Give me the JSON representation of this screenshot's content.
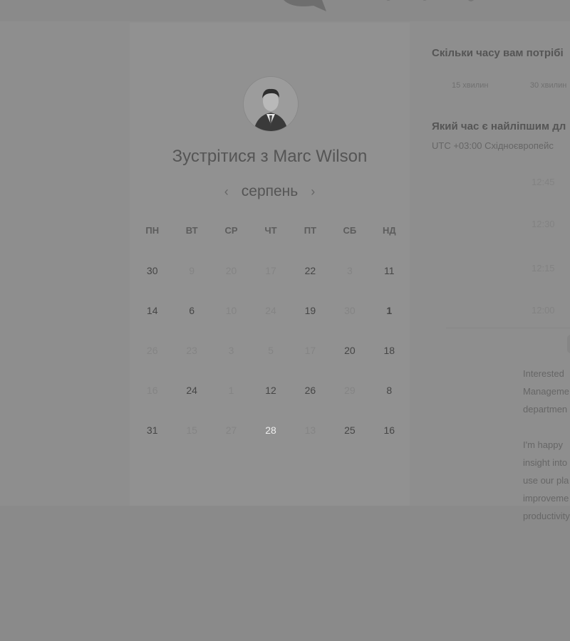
{
  "colors": {
    "page_background": "#8a8a8a",
    "card_background": "#919191",
    "selected_day": "#6e6e6e",
    "text_dark": "#454545",
    "text_muted": "#848484"
  },
  "icons": {
    "prev": "‹",
    "next": "›"
  },
  "calendar": {
    "title": "Зустрітися з Marc Wilson",
    "month": "серпень",
    "weekdays": [
      "ПН",
      "ВТ",
      "СР",
      "ЧТ",
      "ПТ",
      "СБ",
      "НД"
    ],
    "weeks": [
      [
        {
          "d": "30",
          "a": true
        },
        {
          "d": "9",
          "a": false
        },
        {
          "d": "20",
          "a": false
        },
        {
          "d": "17",
          "a": false
        },
        {
          "d": "22",
          "a": true
        },
        {
          "d": "3",
          "a": false
        },
        {
          "d": "11",
          "a": true
        }
      ],
      [
        {
          "d": "14",
          "a": true
        },
        {
          "d": "6",
          "a": true
        },
        {
          "d": "10",
          "a": false
        },
        {
          "d": "24",
          "a": false
        },
        {
          "d": "19",
          "a": true
        },
        {
          "d": "30",
          "a": false
        },
        {
          "d": "1",
          "a": true,
          "b": true
        }
      ],
      [
        {
          "d": "26",
          "a": false
        },
        {
          "d": "23",
          "a": false
        },
        {
          "d": "3",
          "a": false
        },
        {
          "d": "5",
          "a": false
        },
        {
          "d": "17",
          "a": false
        },
        {
          "d": "20",
          "a": true
        },
        {
          "d": "18",
          "a": true
        }
      ],
      [
        {
          "d": "16",
          "a": false
        },
        {
          "d": "24",
          "a": true
        },
        {
          "d": "1",
          "a": false
        },
        {
          "d": "12",
          "a": true
        },
        {
          "d": "26",
          "a": true
        },
        {
          "d": "29",
          "a": false
        },
        {
          "d": "8",
          "a": true
        }
      ],
      [
        {
          "d": "31",
          "a": true
        },
        {
          "d": "15",
          "a": false
        },
        {
          "d": "27",
          "a": false
        },
        {
          "d": "28",
          "a": true,
          "s": true
        },
        {
          "d": "13",
          "a": false
        },
        {
          "d": "25",
          "a": true
        },
        {
          "d": "16",
          "a": true
        }
      ]
    ]
  },
  "booking": {
    "duration_question": "Скільки часу вам потрібі",
    "durations": [
      "15 хвилин",
      "30 хвилин"
    ],
    "time_question": "Який час є найліпшим дл",
    "timezone": "UTC +03:00 Східноєвропейс",
    "slots": [
      "12:45",
      "12:30",
      "12:15",
      "12:00"
    ],
    "description": [
      "Interested",
      "Manageme",
      "departmen",
      "",
      "I'm happy",
      "insight into",
      "use our pla",
      "improveme",
      "productivity"
    ]
  }
}
